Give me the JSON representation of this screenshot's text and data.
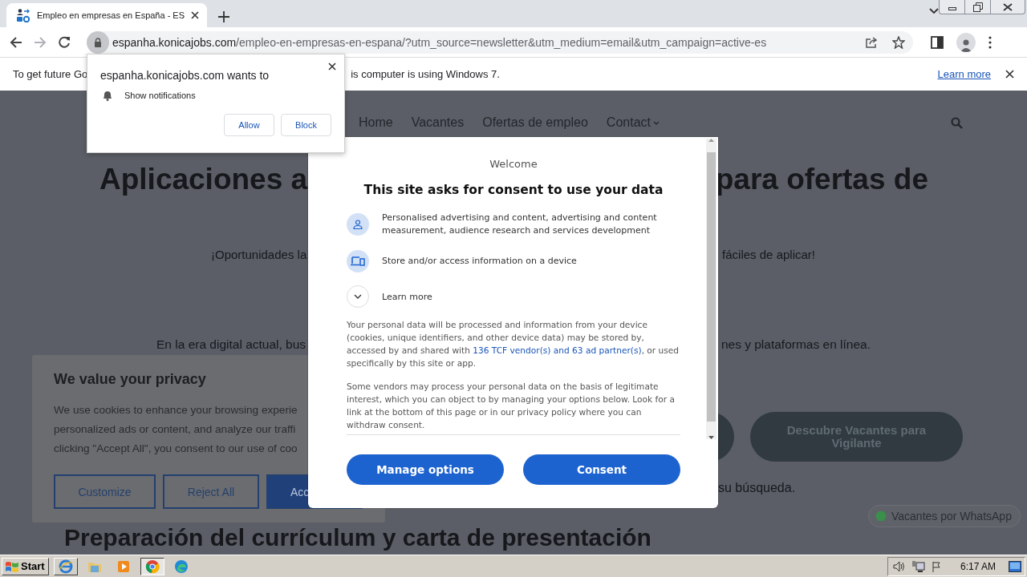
{
  "browser": {
    "tab": {
      "title": "Empleo en empresas en España - ES",
      "selected": true
    },
    "address": {
      "host": "espanha.konicajobs.com",
      "path": "/empleo-en-empresas-en-espana/?utm_source=newsletter&utm_medium=email&utm_campaign=active-es"
    },
    "infobar": {
      "text_left": "To get future Go",
      "text_right": "is computer is using Windows 7.",
      "link": "Learn more"
    }
  },
  "notification_prompt": {
    "title": "espanha.konicajobs.com wants to",
    "permission": "Show notifications",
    "buttons": [
      "Allow",
      "Block"
    ]
  },
  "website": {
    "nav": [
      "Home",
      "Vacantes",
      "Ofertas de empleo",
      "Contact"
    ],
    "heading": {
      "left": "Aplicaciones a",
      "right": "para ofertas de"
    },
    "intro": {
      "left": "¡Oportunidades la",
      "right": "fáciles de aplicar!"
    },
    "paragraph": {
      "left": "En la era digital actual, bus",
      "right": "nes y plataformas en línea."
    },
    "cta_button": "Descubre Vacantes para Vigilante",
    "note": "su búsqueda.",
    "whatsapp_button": "Vacantes por WhatsApp",
    "subheading": "Preparación del currículum y carta de presentación"
  },
  "cookie_banner": {
    "title": "We value your privacy",
    "lines": [
      "We use cookies to enhance your browsing experie",
      "personalized ads or content, and analyze our traffi",
      "clicking \"Accept All\", you consent to our use of coo"
    ],
    "buttons": [
      {
        "label": "Customize",
        "kind": "outline"
      },
      {
        "label": "Reject All",
        "kind": "outline"
      },
      {
        "label": "Acc",
        "kind": "filled"
      }
    ]
  },
  "consent_dialog": {
    "welcome": "Welcome",
    "title": "This site asks for consent to use your data",
    "purposes": [
      {
        "kind": "person",
        "text": "Personalised advertising and content, advertising and content measurement, audience research and services development"
      },
      {
        "kind": "device",
        "text": "Store and/or access information on a device"
      }
    ],
    "learn_more": {
      "label": "Learn more",
      "expanded": false
    },
    "paragraph_1": {
      "before": "Your personal data will be processed and information from your device (cookies, unique identifiers, and other device data) may be stored by, accessed by and shared with ",
      "link": "136 TCF vendor(s) and 63 ad partner(s)",
      "after": ", or used specifically by this site or app."
    },
    "paragraph_2": "Some vendors may process your personal data on the basis of legitimate interest, which you can object to by managing your options below. Look for a link at the bottom of this page or in our privacy policy where you can withdraw consent.",
    "buttons": [
      "Manage options",
      "Consent"
    ]
  },
  "taskbar": {
    "start": "Start",
    "time": "6:17 AM"
  }
}
